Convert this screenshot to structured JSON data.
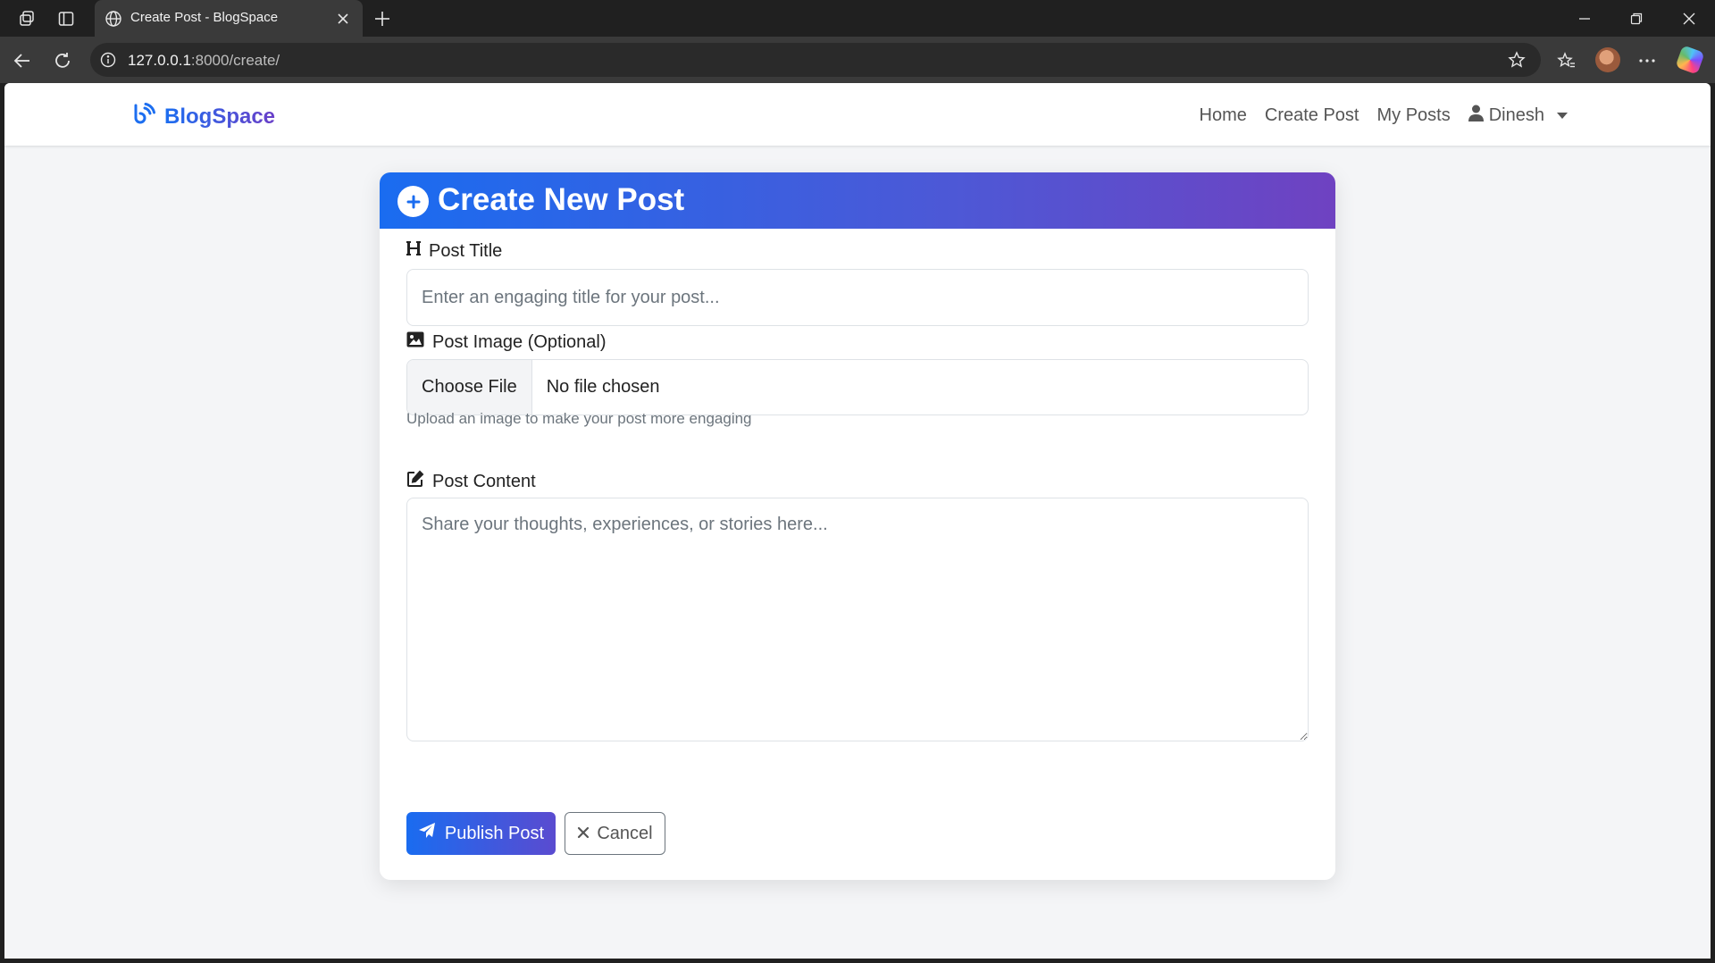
{
  "browser": {
    "tab_title": "Create Post - BlogSpace",
    "url_host": "127.0.0.1",
    "url_path": ":8000/create/"
  },
  "site_nav": {
    "brand": "BlogSpace",
    "links": [
      "Home",
      "Create Post",
      "My Posts"
    ],
    "user": "Dinesh"
  },
  "form": {
    "header_title": "Create New Post",
    "title_label": "Post Title",
    "title_placeholder": "Enter an engaging title for your post...",
    "image_label": "Post Image (Optional)",
    "choose_file": "Choose File",
    "no_file": "No file chosen",
    "image_help": "Upload an image to make your post more engaging",
    "content_label": "Post Content",
    "content_placeholder": "Share your thoughts, experiences, or stories here...",
    "publish_button": "Publish Post",
    "cancel_button": "Cancel"
  },
  "colors": {
    "accent_start": "#1a6cf0",
    "accent_end": "#6f42c1"
  },
  "icons": {
    "header": "plus-circle-icon",
    "title": "heading-icon",
    "image": "image-icon",
    "content": "edit-icon",
    "publish": "paper-plane-icon",
    "cancel": "x-icon",
    "brand": "blog-icon",
    "user": "user-icon"
  }
}
